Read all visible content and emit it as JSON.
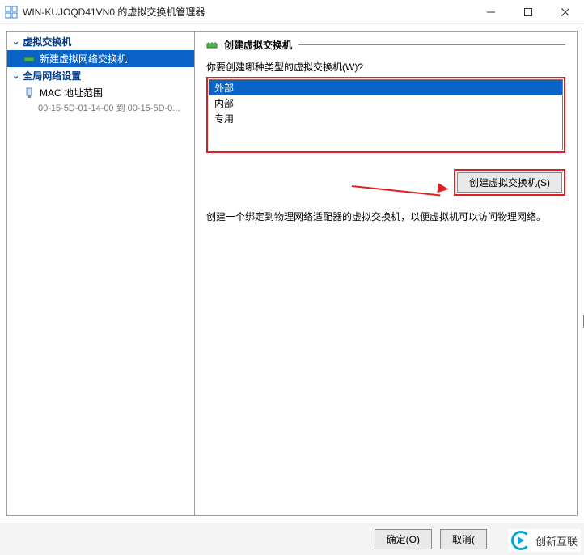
{
  "window": {
    "title": "WIN-KUJOQD41VN0 的虚拟交换机管理器"
  },
  "tree": {
    "section1": "虚拟交换机",
    "item_new": "新建虚拟网络交换机",
    "section2": "全局网络设置",
    "item_mac": "MAC 地址范围",
    "mac_range": "00-15-5D-01-14-00 到 00-15-5D-0..."
  },
  "right": {
    "header": "创建虚拟交换机",
    "prompt": "你要创建哪种类型的虚拟交换机(W)?",
    "options": [
      "外部",
      "内部",
      "专用"
    ],
    "create_btn": "创建虚拟交换机(S)",
    "desc": "创建一个绑定到物理网络适配器的虚拟交换机，以便虚拟机可以访问物理网络。"
  },
  "footer": {
    "ok": "确定(O)",
    "cancel": "取消("
  },
  "watermark": {
    "text": "创新互联"
  }
}
